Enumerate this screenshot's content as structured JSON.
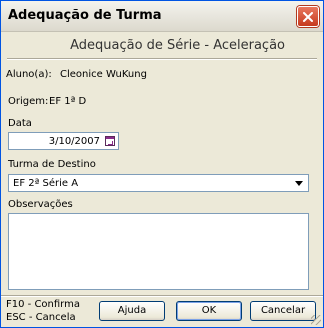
{
  "window": {
    "title": "Adequação de Turma",
    "close_icon": "close-icon"
  },
  "header": {
    "heading": "Adequação de Série - Aceleração"
  },
  "student": {
    "label": "Aluno(a):",
    "name": "Cleonice WuKung"
  },
  "origin": {
    "label": "Origem:",
    "value": "EF 1ª D"
  },
  "date": {
    "label": "Data",
    "value": "3/10/2007",
    "calendar_icon": "calendar-icon"
  },
  "destination": {
    "label": "Turma de Destino",
    "selected": "EF 2ª Série A"
  },
  "notes": {
    "label": "Observações",
    "value": ""
  },
  "footer": {
    "hint_confirm": "F10 - Confirma",
    "hint_cancel": "ESC - Cancela",
    "help_label": "Ajuda",
    "ok_label": "OK",
    "cancel_label": "Cancelar"
  },
  "colors": {
    "window_bg": "#ece9d8",
    "border_accent": "#0054e3",
    "close_button": "#c6391d",
    "field_border": "#7f9db9"
  }
}
